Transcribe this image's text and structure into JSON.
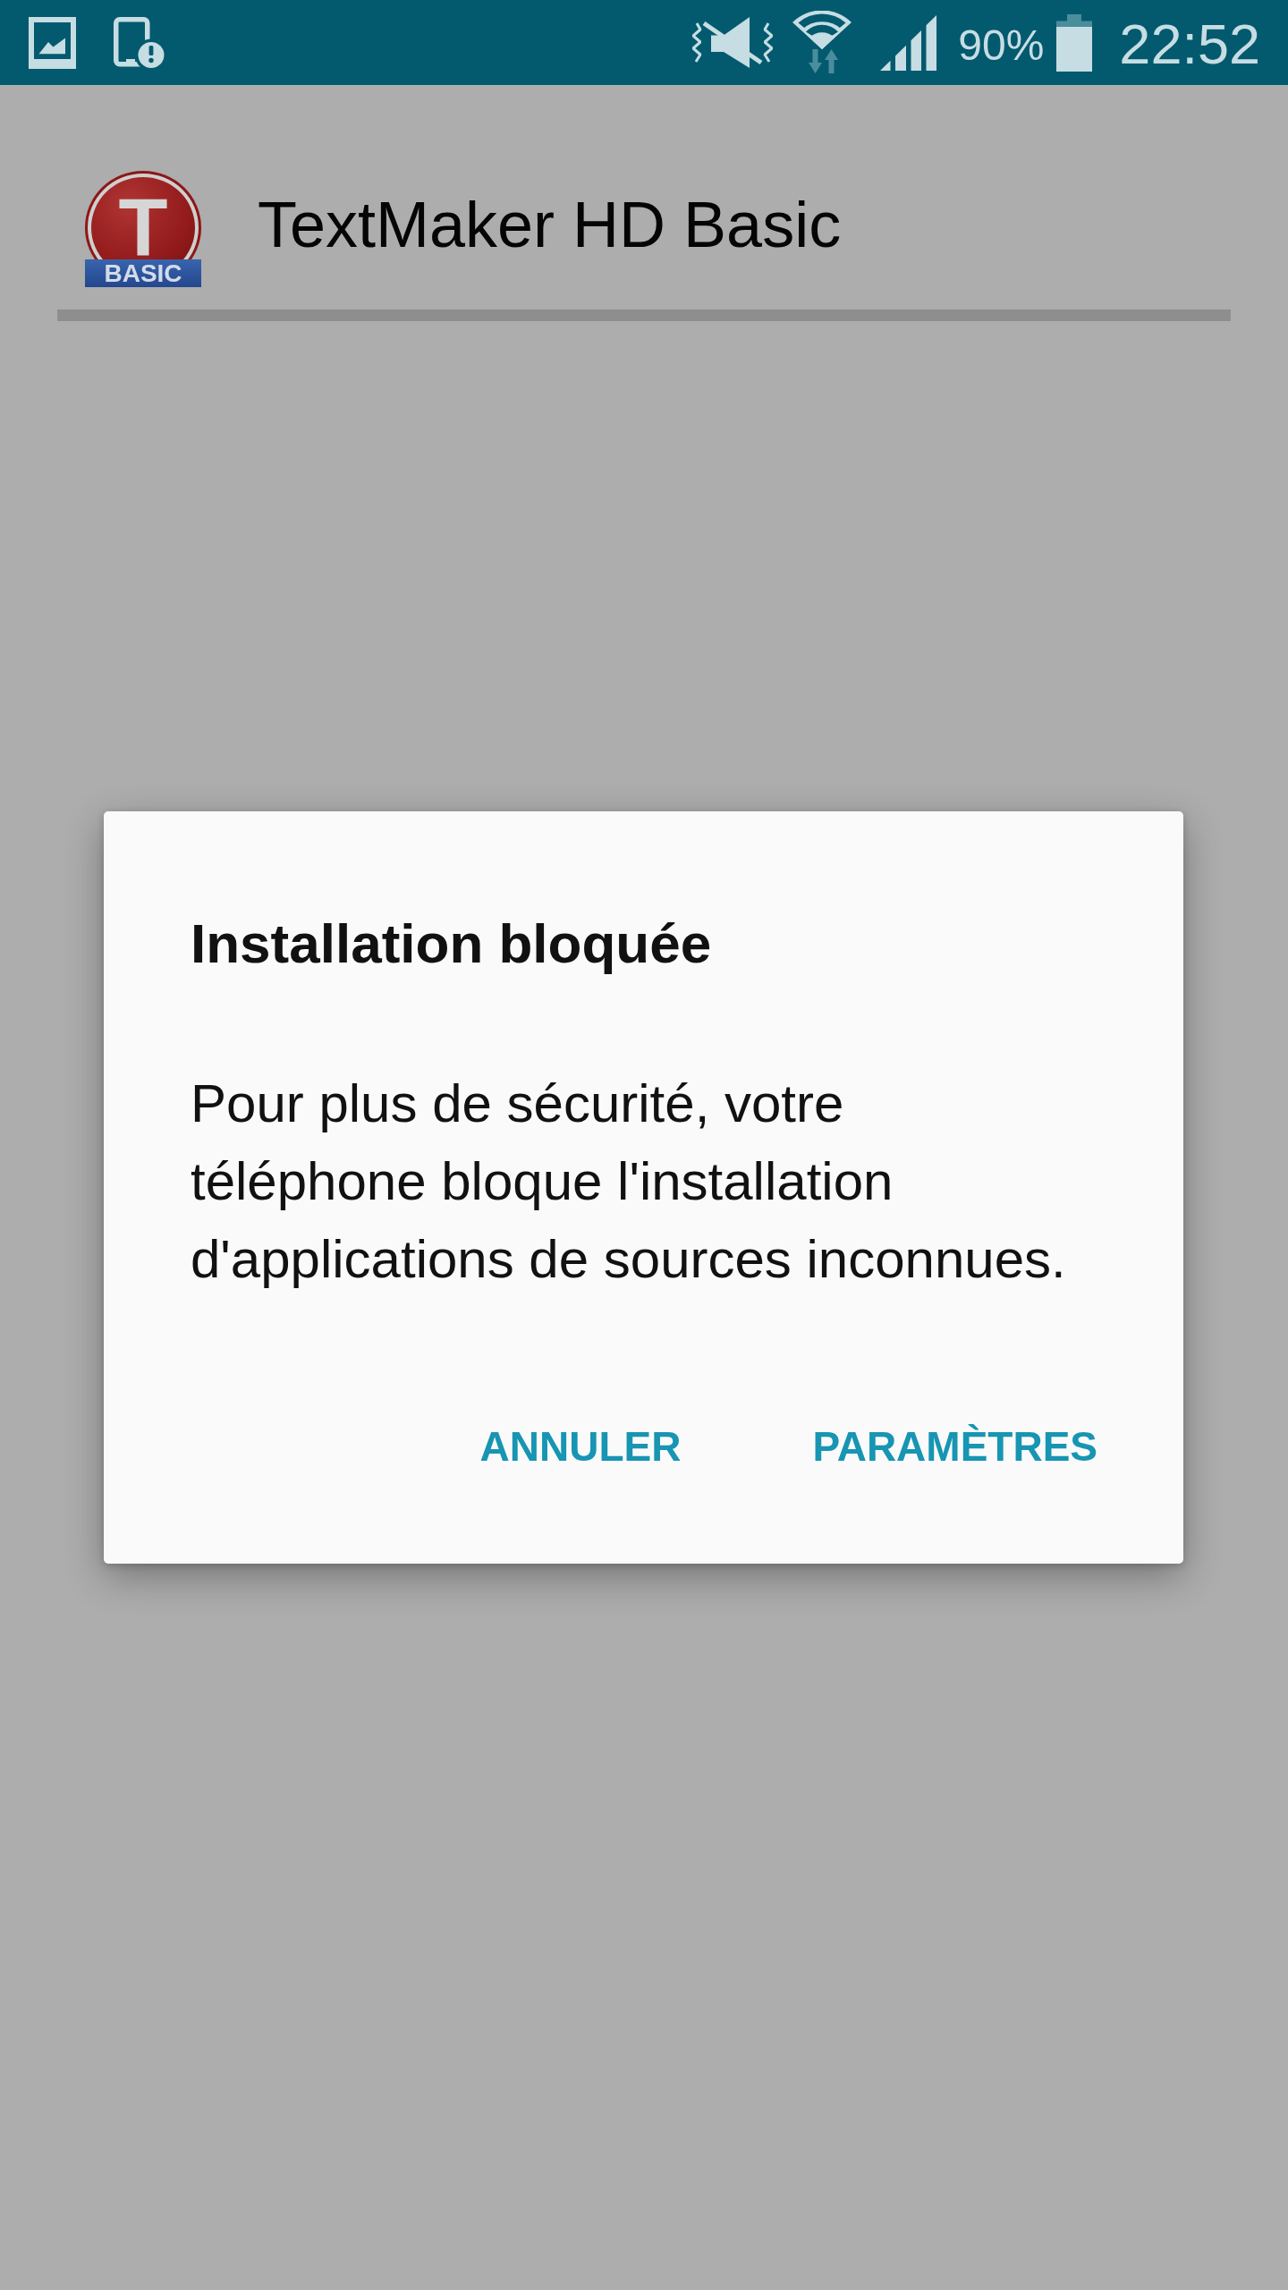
{
  "status_bar": {
    "battery_percent": "90%",
    "time": "22:52"
  },
  "app": {
    "logo": {
      "letter": "T",
      "badge": "BASIC"
    },
    "title": "TextMaker HD Basic"
  },
  "dialog": {
    "title": "Installation bloquée",
    "message": "Pour plus de sécurité, votre téléphone bloque l'installation d'applications de sources inconnues.",
    "buttons": [
      "ANNULER",
      "PARAMÈTRES"
    ]
  }
}
